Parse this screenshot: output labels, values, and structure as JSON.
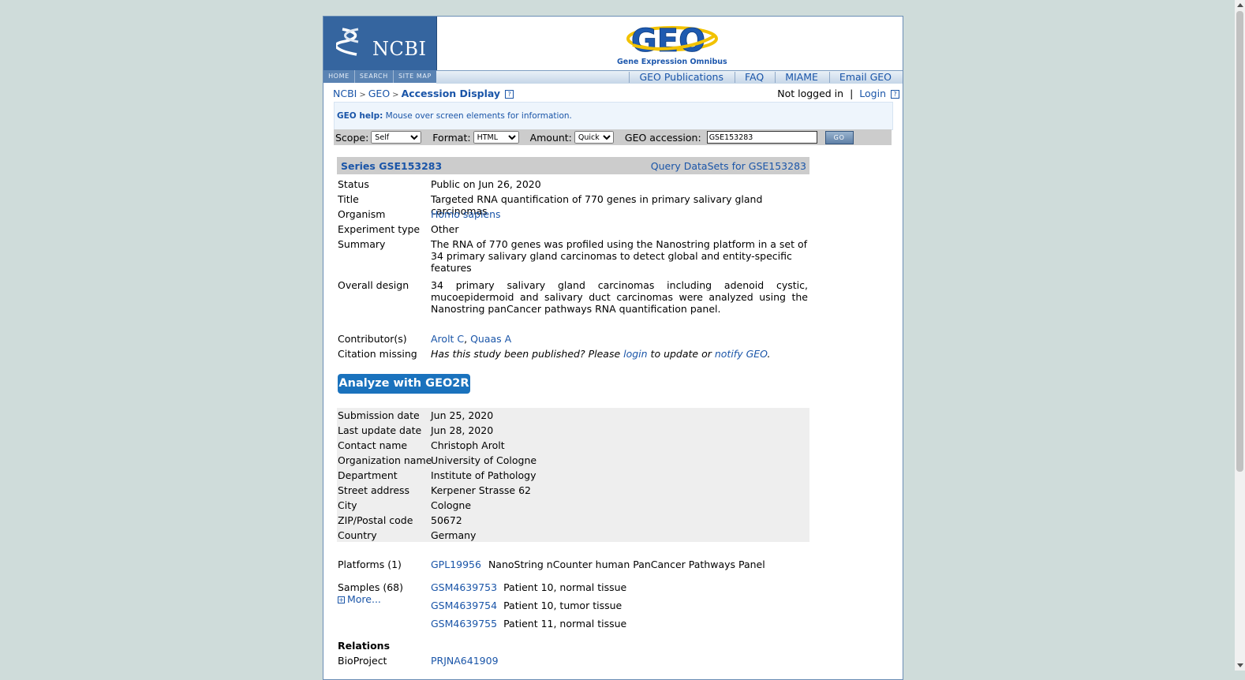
{
  "header": {
    "ncbi_logo": "NCBI",
    "ncbi_nav": [
      "HOME",
      "SEARCH",
      "SITE MAP"
    ],
    "geo_logo": "GEO",
    "geo_subtitle": "Gene Expression Omnibus",
    "top_links": [
      "GEO Publications",
      "FAQ",
      "MIAME",
      "Email GEO"
    ]
  },
  "breadcrumb": {
    "ncbi": "NCBI",
    "geo": "GEO",
    "current": "Accession Display",
    "sep": ">"
  },
  "login_area": {
    "status": "Not logged in",
    "sep": "|",
    "login": "Login"
  },
  "help": {
    "label": "GEO help:",
    "text": "Mouse over screen elements for information."
  },
  "search": {
    "scope_label": "Scope:",
    "scope_value": "Self",
    "format_label": "Format:",
    "format_value": "HTML",
    "amount_label": "Amount:",
    "amount_value": "Quick",
    "accession_label": "GEO accession:",
    "accession_value": "GSE153283",
    "go_label": "GO"
  },
  "series": {
    "title": "Series GSE153283",
    "query_link": "Query DataSets for GSE153283",
    "fields": {
      "status": {
        "k": "Status",
        "v": "Public on Jun 26, 2020"
      },
      "title": {
        "k": "Title",
        "v": "Targeted RNA quantification of 770 genes in primary salivary gland carcinomas"
      },
      "organism": {
        "k": "Organism",
        "v": "Homo sapiens"
      },
      "experiment_type": {
        "k": "Experiment type",
        "v": "Other"
      },
      "summary": {
        "k": "Summary",
        "v": "The RNA of 770 genes was profiled using the Nanostring platform in a set of 34 primary salivary gland carcinomas to detect global and entity-specific features"
      },
      "overall_design": {
        "k": "Overall design",
        "v": "34 primary salivary gland carcinomas including adenoid cystic, mucoepidermoid and salivary duct carcinomas were analyzed using the Nanostring panCancer pathways RNA quantification panel."
      },
      "contributors": {
        "k": "Contributor(s)",
        "c1": "Arolt C",
        "sep": ", ",
        "c2": "Quaas A"
      },
      "citation": {
        "k": "Citation missing",
        "p1": "Has this study been published? Please ",
        "login": "login",
        "p2": " to update or ",
        "notify": "notify GEO",
        "p3": "."
      }
    },
    "geo2r_button": "Analyze with GEO2R",
    "contact": [
      {
        "k": "Submission date",
        "v": "Jun 25, 2020"
      },
      {
        "k": "Last update date",
        "v": "Jun 28, 2020"
      },
      {
        "k": "Contact name",
        "v": "Christoph Arolt"
      },
      {
        "k": "Organization name",
        "v": "University of Cologne"
      },
      {
        "k": "Department",
        "v": "Institute of Pathology"
      },
      {
        "k": "Street address",
        "v": "Kerpener Strasse 62"
      },
      {
        "k": "City",
        "v": "Cologne"
      },
      {
        "k": "ZIP/Postal code",
        "v": "50672"
      },
      {
        "k": "Country",
        "v": "Germany"
      }
    ],
    "platforms": {
      "k": "Platforms (1)",
      "id": "GPL19956",
      "name": "NanoString nCounter human PanCancer Pathways Panel"
    },
    "samples": {
      "k": "Samples (68)",
      "more": "More...",
      "items": [
        {
          "id": "GSM4639753",
          "name": "Patient 10, normal tissue"
        },
        {
          "id": "GSM4639754",
          "name": "Patient 10, tumor tissue"
        },
        {
          "id": "GSM4639755",
          "name": "Patient 11, normal tissue"
        }
      ]
    },
    "relations": {
      "heading": "Relations",
      "bioproject_k": "BioProject",
      "bioproject_v": "PRJNA641909"
    }
  },
  "colors": {
    "link": "#1a55a8",
    "ncbi_blue": "#35659f",
    "gray_bar": "#cccccc",
    "contact_bg": "#eeeeee",
    "geo2r_button": "#1a72bd"
  },
  "icons": [
    "ncbi-helix-icon",
    "help-question-icon",
    "expand-plus-icon"
  ]
}
